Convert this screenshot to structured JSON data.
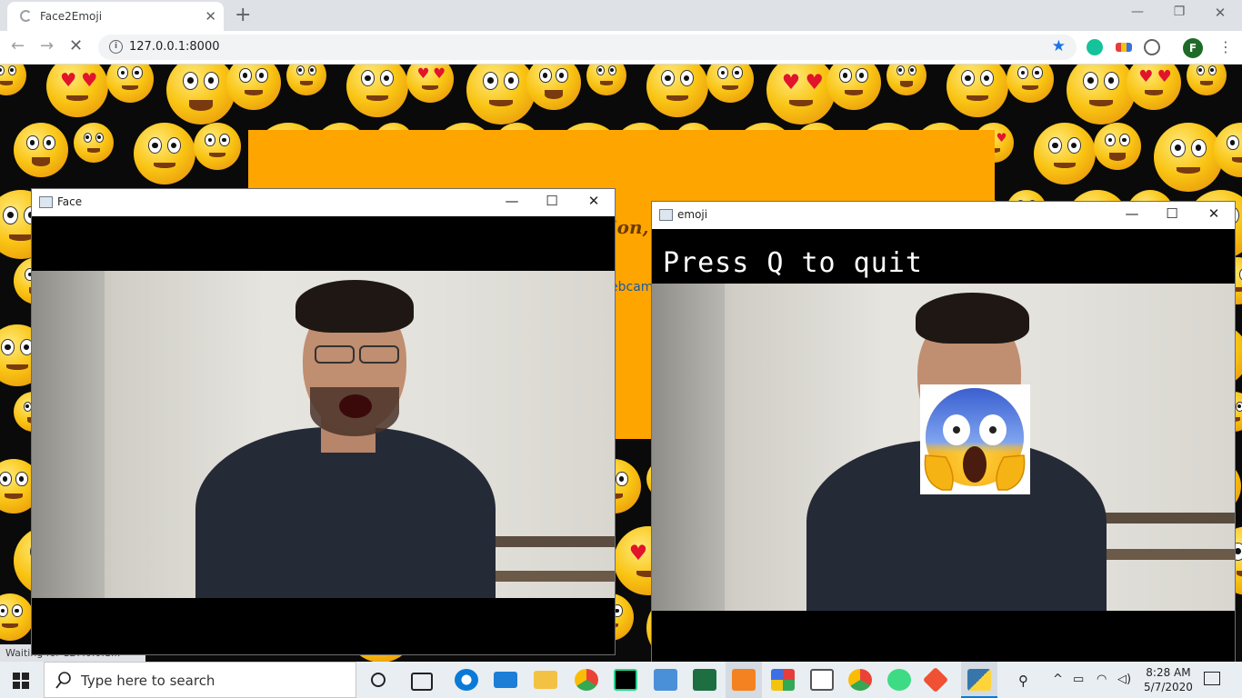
{
  "browser": {
    "tab_title": "Face2Emoji",
    "url": "127.0.0.1:8000",
    "profile_initial": "F",
    "status_text": "Waiting for 127.0.0.1..."
  },
  "page": {
    "tagline_fragment": "ion,",
    "webcam_fragment": "ebcam",
    "background": "emoji-pattern",
    "banner_color": "#ffa500"
  },
  "windows": {
    "face": {
      "title": "Face"
    },
    "emoji": {
      "title": "emoji",
      "overlay_text": "Press Q to quit",
      "overlay_emoji": "face-screaming-in-fear"
    }
  },
  "taskbar": {
    "search_placeholder": "Type here to search",
    "time": "8:28 AM",
    "date": "5/7/2020",
    "apps": [
      "task-view",
      "edge",
      "mail",
      "file-explorer",
      "chrome-profile",
      "pycharm",
      "network-app",
      "excel",
      "sublime",
      "app-grid",
      "store",
      "chrome",
      "maps",
      "git",
      "python"
    ]
  },
  "colors": {
    "accent": "#1a73e8",
    "banner": "#ffa500",
    "profile": "#1e6b28"
  }
}
